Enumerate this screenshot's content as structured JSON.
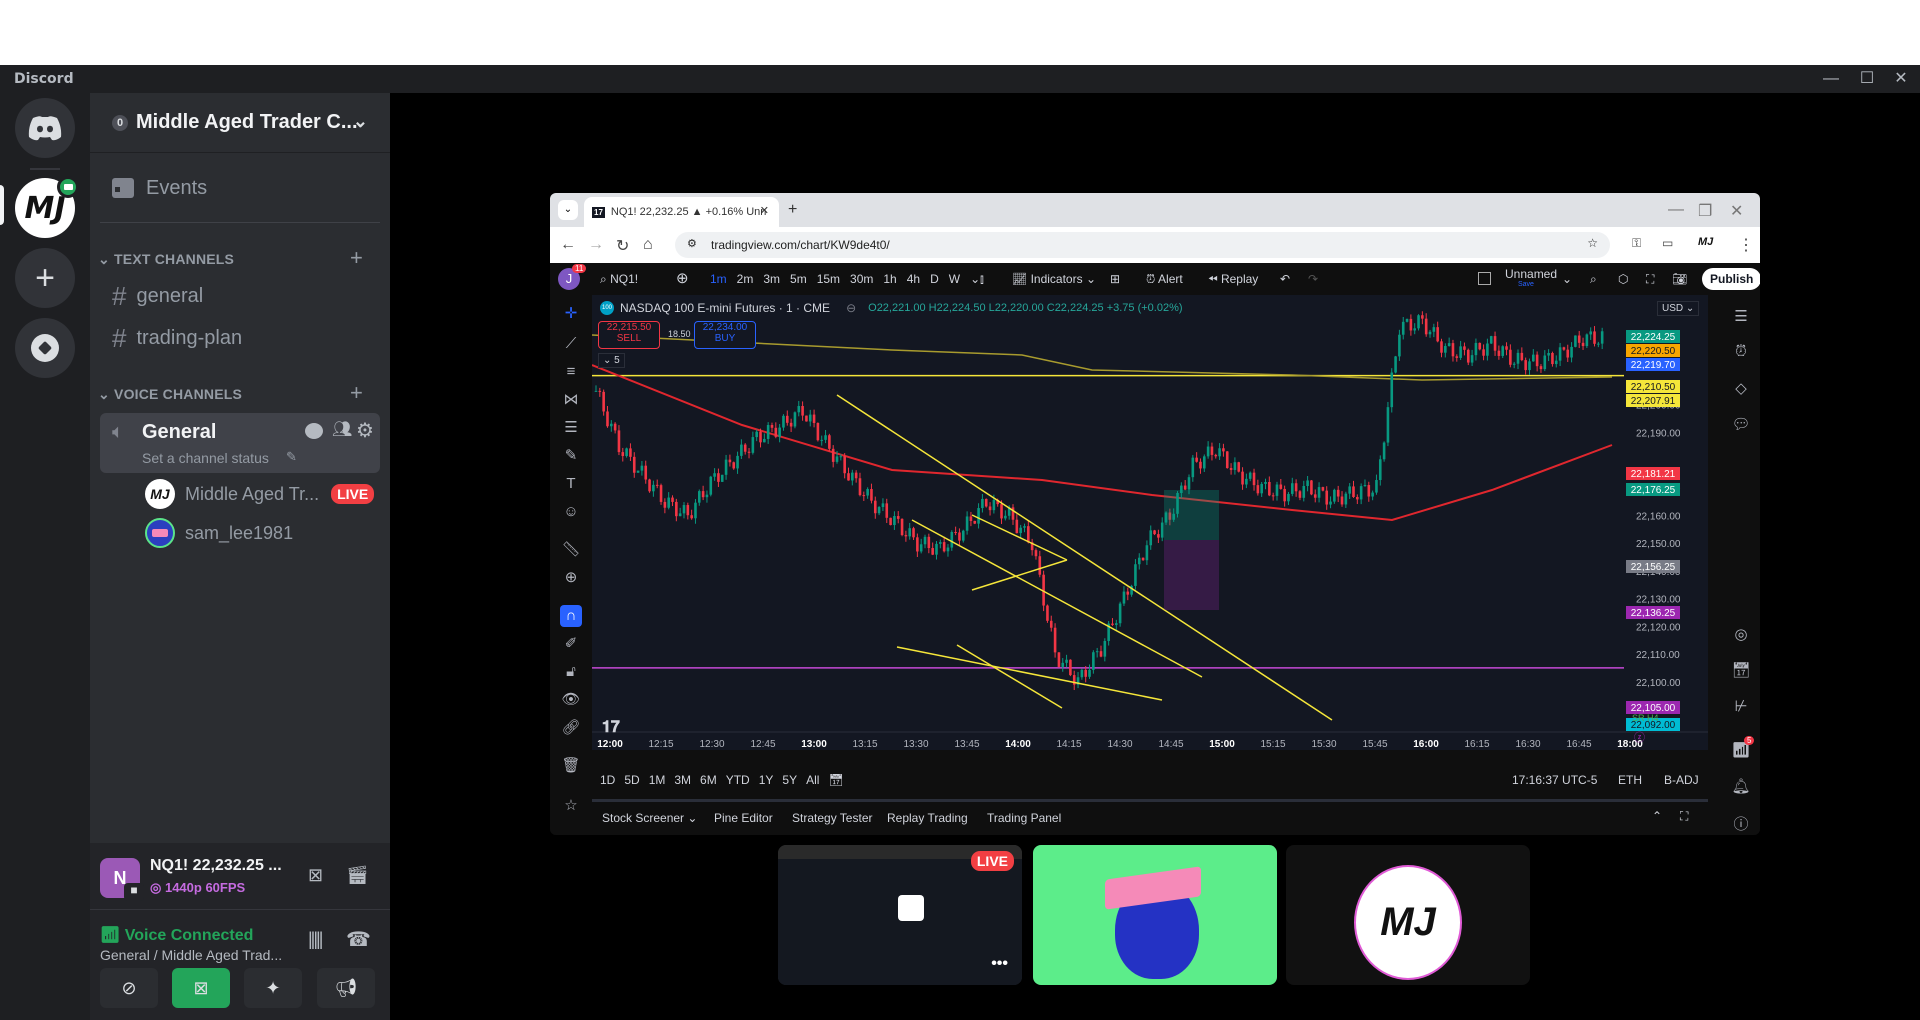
{
  "window": {
    "app_name": "Discord",
    "minimize": "—",
    "maximize": "☐",
    "close": "✕"
  },
  "server_rail": {
    "items": [
      {
        "name": "Direct Messages",
        "icon": "discord-icon"
      },
      {
        "name": "Middle Aged Trader Community",
        "icon": "mj-logo",
        "badge": "screen-share"
      },
      {
        "name": "Add a Server",
        "icon": "plus-icon"
      },
      {
        "name": "Discover",
        "icon": "compass-icon"
      }
    ]
  },
  "sidebar": {
    "server_name": "Middle Aged Trader C...",
    "boost_count": "0",
    "events_label": "Events",
    "text_category": "TEXT CHANNELS",
    "text_channels": [
      "general",
      "trading-plan"
    ],
    "voice_category": "VOICE CHANNELS",
    "voice_channel": {
      "name": "General",
      "status_placeholder": "Set a channel status"
    },
    "voice_users": [
      {
        "name": "Middle Aged Tr...",
        "live": "LIVE"
      },
      {
        "name": "sam_lee1981"
      }
    ]
  },
  "panel": {
    "stream_title": "NQ1! 22,232.25 ...",
    "stream_quality": "1440p 60FPS",
    "avatar_letter": "N",
    "voice_status": "Voice Connected",
    "voice_location": "General / Middle Aged Trad..."
  },
  "browser": {
    "tab_title": "NQ1! 22,232.25 ▲ +0.16% Unn",
    "url": "tradingview.com/chart/KW9de4t0/"
  },
  "tradingview": {
    "avatar_letter": "J",
    "notif_count": "11",
    "symbol": "NQ1!",
    "intervals": [
      "1m",
      "2m",
      "3m",
      "5m",
      "15m",
      "30m",
      "1h",
      "4h",
      "D",
      "W"
    ],
    "active_interval": "1m",
    "indicators_label": "Indicators",
    "alert_label": "Alert",
    "replay_label": "Replay",
    "layout_name": "Unnamed",
    "save_label": "Save",
    "publish_label": "Publish",
    "instrument": "NASDAQ 100 E-mini Futures · 1 · CME",
    "ohlc": {
      "o": "22,221.00",
      "h": "22,224.50",
      "l": "22,220.00",
      "c": "22,224.25",
      "chg": "+3.75 (+0.02%)"
    },
    "sell": {
      "price": "22,215.50",
      "label": "SELL"
    },
    "spread": "18.50",
    "buy": {
      "price": "22,234.00",
      "label": "BUY"
    },
    "indicator_count": "5",
    "currency": "USD",
    "sr_label": "SR H4",
    "range_buttons": [
      "1D",
      "5D",
      "1M",
      "3M",
      "6M",
      "YTD",
      "1Y",
      "5Y",
      "All"
    ],
    "clock": "17:16:37 UTC-5",
    "session": "ETH",
    "adj": "B-ADJ",
    "bottom_tabs": [
      "Stock Screener",
      "Pine Editor",
      "Strategy Tester",
      "Replay Trading",
      "Trading Panel"
    ],
    "right_badge": "5"
  },
  "chart_data": {
    "type": "candlestick",
    "title": "NASDAQ 100 E-mini Futures · 1 · CME",
    "x_ticks": [
      "12:00",
      "12:15",
      "12:30",
      "12:45",
      "13:00",
      "13:15",
      "13:30",
      "13:45",
      "14:00",
      "14:15",
      "14:30",
      "14:45",
      "15:00",
      "15:15",
      "15:30",
      "15:45",
      "16:00",
      "16:15",
      "16:30",
      "16:45",
      "18:00"
    ],
    "y_ticks": [
      "22,200.00",
      "22,190.00",
      "22,170.00",
      "22,160.00",
      "22,150.00",
      "22,140.00",
      "22,130.00",
      "22,120.00",
      "22,110.00",
      "22,100.00"
    ],
    "ylim": [
      22088,
      22236
    ],
    "price_labels": [
      {
        "value": "22,224.25",
        "color": "#089981"
      },
      {
        "value": "22,220.50",
        "color": "#f7a600"
      },
      {
        "value": "22,219.70",
        "color": "#2962ff"
      },
      {
        "value": "22,210.50",
        "color": "#f5e63a"
      },
      {
        "value": "22,207.91",
        "color": "#f5e63a"
      },
      {
        "value": "22,181.21",
        "color": "#f23645"
      },
      {
        "value": "22,176.25",
        "color": "#089981"
      },
      {
        "value": "22,156.25",
        "color": "#787b86"
      },
      {
        "value": "22,136.25",
        "color": "#9c27b0"
      },
      {
        "value": "22,105.00",
        "color": "#9c27b0"
      },
      {
        "value": "22,092.00",
        "color": "#00bcd4"
      }
    ],
    "close_path": [
      22205,
      22185,
      22175,
      22165,
      22160,
      22172,
      22180,
      22188,
      22192,
      22198,
      22186,
      22175,
      22165,
      22158,
      22150,
      22148,
      22155,
      22165,
      22160,
      22150,
      22110,
      22100,
      22112,
      22130,
      22150,
      22160,
      22178,
      22184,
      22175,
      22170,
      22168,
      22170,
      22166,
      22168,
      22170,
      22228,
      22230,
      22220,
      22218,
      22222,
      22216,
      22215,
      22218,
      22224
    ],
    "hlines": [
      {
        "name": "resistance",
        "value": 22210.5,
        "color": "#f5e63a"
      },
      {
        "name": "support-sr-h4",
        "value": 22105,
        "color": "#c548d6"
      }
    ]
  }
}
